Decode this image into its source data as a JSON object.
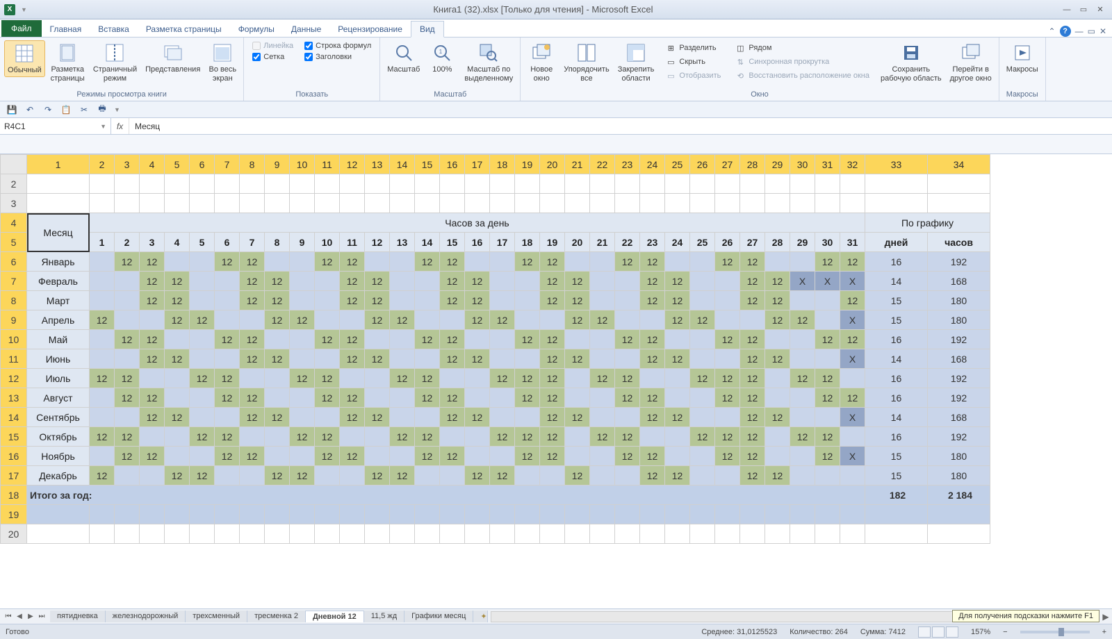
{
  "title": "Книга1 (32).xlsx  [Только для чтения]  -  Microsoft Excel",
  "tabs": {
    "file": "Файл",
    "home": "Главная",
    "insert": "Вставка",
    "layout": "Разметка страницы",
    "formulas": "Формулы",
    "data": "Данные",
    "review": "Рецензирование",
    "view": "Вид"
  },
  "ribbon": {
    "views": {
      "normal": "Обычный",
      "page_layout": "Разметка\nстраницы",
      "page_break": "Страничный\nрежим",
      "custom": "Представления",
      "full": "Во весь\nэкран",
      "group": "Режимы просмотра книги"
    },
    "show": {
      "ruler": "Линейка",
      "formula_bar": "Строка формул",
      "gridlines": "Сетка",
      "headings": "Заголовки",
      "group": "Показать"
    },
    "zoom": {
      "zoom": "Масштаб",
      "hundred": "100%",
      "selection": "Масштаб по\nвыделенному",
      "group": "Масштаб"
    },
    "window": {
      "new": "Новое\nокно",
      "arrange": "Упорядочить\nвсе",
      "freeze": "Закрепить\nобласти",
      "split": "Разделить",
      "hide": "Скрыть",
      "unhide": "Отобразить",
      "side": "Рядом",
      "sync": "Синхронная прокрутка",
      "reset": "Восстановить расположение окна",
      "save_ws": "Сохранить\nрабочую область",
      "switch": "Перейти в\nдругое окно",
      "group": "Окно"
    },
    "macros": {
      "label": "Макросы",
      "group": "Макросы"
    }
  },
  "namebox": "R4C1",
  "formula": "Месяц",
  "cols": [
    "1",
    "2",
    "3",
    "4",
    "5",
    "6",
    "7",
    "8",
    "9",
    "10",
    "11",
    "12",
    "13",
    "14",
    "15",
    "16",
    "17",
    "18",
    "19",
    "20",
    "21",
    "22",
    "23",
    "24",
    "25",
    "26",
    "27",
    "28",
    "29",
    "30",
    "31",
    "32",
    "33",
    "34"
  ],
  "rows": [
    "2",
    "3",
    "4",
    "5",
    "6",
    "7",
    "8",
    "9",
    "10",
    "11",
    "12",
    "13",
    "14",
    "15",
    "16",
    "17",
    "18",
    "19",
    "20"
  ],
  "table": {
    "month_header": "Месяц",
    "hours_per_day": "Часов за день",
    "by_schedule": "По графику",
    "days": [
      "1",
      "2",
      "3",
      "4",
      "5",
      "6",
      "7",
      "8",
      "9",
      "10",
      "11",
      "12",
      "13",
      "14",
      "15",
      "16",
      "17",
      "18",
      "19",
      "20",
      "21",
      "22",
      "23",
      "24",
      "25",
      "26",
      "27",
      "28",
      "29",
      "30",
      "31"
    ],
    "days_label": "дней",
    "hours_label": "часов",
    "months": [
      {
        "name": "Январь",
        "cells": [
          "",
          "12",
          "12",
          "",
          "",
          "12",
          "12",
          "",
          "",
          "12",
          "12",
          "",
          "",
          "12",
          "12",
          "",
          "",
          "12",
          "12",
          "",
          "",
          "12",
          "12",
          "",
          "",
          "12",
          "12",
          "",
          "",
          "12",
          "12"
        ],
        "days": "16",
        "hours": "192"
      },
      {
        "name": "Февраль",
        "cells": [
          "",
          "",
          "12",
          "12",
          "",
          "",
          "12",
          "12",
          "",
          "",
          "12",
          "12",
          "",
          "",
          "12",
          "12",
          "",
          "",
          "12",
          "12",
          "",
          "",
          "12",
          "12",
          "",
          "",
          "12",
          "12",
          "X",
          "X",
          "X"
        ],
        "days": "14",
        "hours": "168"
      },
      {
        "name": "Март",
        "cells": [
          "",
          "",
          "12",
          "12",
          "",
          "",
          "12",
          "12",
          "",
          "",
          "12",
          "12",
          "",
          "",
          "12",
          "12",
          "",
          "",
          "12",
          "12",
          "",
          "",
          "12",
          "12",
          "",
          "",
          "12",
          "12",
          "",
          "",
          "12"
        ],
        "days": "15",
        "hours": "180"
      },
      {
        "name": "Апрель",
        "cells": [
          "12",
          "",
          "",
          "12",
          "12",
          "",
          "",
          "12",
          "12",
          "",
          "",
          "12",
          "12",
          "",
          "",
          "12",
          "12",
          "",
          "",
          "12",
          "12",
          "",
          "",
          "12",
          "12",
          "",
          "",
          "12",
          "12",
          "",
          "X"
        ],
        "days": "15",
        "hours": "180"
      },
      {
        "name": "Май",
        "cells": [
          "",
          "12",
          "12",
          "",
          "",
          "12",
          "12",
          "",
          "",
          "12",
          "12",
          "",
          "",
          "12",
          "12",
          "",
          "",
          "12",
          "12",
          "",
          "",
          "12",
          "12",
          "",
          "",
          "12",
          "12",
          "",
          "",
          "12",
          "12"
        ],
        "days": "16",
        "hours": "192"
      },
      {
        "name": "Июнь",
        "cells": [
          "",
          "",
          "12",
          "12",
          "",
          "",
          "12",
          "12",
          "",
          "",
          "12",
          "12",
          "",
          "",
          "12",
          "12",
          "",
          "",
          "12",
          "12",
          "",
          "",
          "12",
          "12",
          "",
          "",
          "12",
          "12",
          "",
          "",
          "X"
        ],
        "days": "14",
        "hours": "168"
      },
      {
        "name": "Июль",
        "cells": [
          "12",
          "12",
          "",
          "",
          "12",
          "12",
          "",
          "",
          "12",
          "12",
          "",
          "",
          "12",
          "12",
          "",
          "",
          "12",
          "12",
          "12",
          "",
          "12",
          "12",
          "",
          "",
          "12",
          "12",
          "12",
          "",
          "12",
          "12",
          ""
        ],
        "days": "16",
        "hours": "192"
      },
      {
        "name": "Август",
        "cells": [
          "",
          "12",
          "12",
          "",
          "",
          "12",
          "12",
          "",
          "",
          "12",
          "12",
          "",
          "",
          "12",
          "12",
          "",
          "",
          "12",
          "12",
          "",
          "",
          "12",
          "12",
          "",
          "",
          "12",
          "12",
          "",
          "",
          "12",
          "12"
        ],
        "days": "16",
        "hours": "192"
      },
      {
        "name": "Сентябрь",
        "cells": [
          "",
          "",
          "12",
          "12",
          "",
          "",
          "12",
          "12",
          "",
          "",
          "12",
          "12",
          "",
          "",
          "12",
          "12",
          "",
          "",
          "12",
          "12",
          "",
          "",
          "12",
          "12",
          "",
          "",
          "12",
          "12",
          "",
          "",
          "X"
        ],
        "days": "14",
        "hours": "168"
      },
      {
        "name": "Октябрь",
        "cells": [
          "12",
          "12",
          "",
          "",
          "12",
          "12",
          "",
          "",
          "12",
          "12",
          "",
          "",
          "12",
          "12",
          "",
          "",
          "12",
          "12",
          "12",
          "",
          "12",
          "12",
          "",
          "",
          "12",
          "12",
          "12",
          "",
          "12",
          "12",
          ""
        ],
        "days": "16",
        "hours": "192"
      },
      {
        "name": "Ноябрь",
        "cells": [
          "",
          "12",
          "12",
          "",
          "",
          "12",
          "12",
          "",
          "",
          "12",
          "12",
          "",
          "",
          "12",
          "12",
          "",
          "",
          "12",
          "12",
          "",
          "",
          "12",
          "12",
          "",
          "",
          "12",
          "12",
          "",
          "",
          "12",
          "X"
        ],
        "days": "15",
        "hours": "180"
      },
      {
        "name": "Декабрь",
        "cells": [
          "12",
          "",
          "",
          "12",
          "12",
          "",
          "",
          "12",
          "12",
          "",
          "",
          "12",
          "12",
          "",
          "",
          "12",
          "12",
          "",
          "",
          "12",
          "",
          "",
          "12",
          "12",
          "",
          "",
          "12",
          "12",
          "",
          "",
          ""
        ],
        "days": "15",
        "hours": "180"
      }
    ],
    "total_label": "Итого за год:",
    "total_days": "182",
    "total_hours": "2 184"
  },
  "sheet_tabs": [
    "пятидневка",
    "железнодорожный",
    "трехсменный",
    "тресменка 2",
    "Дневной 12",
    "11,5 жд",
    "Графики месяц"
  ],
  "active_sheet": 4,
  "status": {
    "ready": "Готово",
    "avg_label": "Среднее:",
    "avg": "31,0125523",
    "count_label": "Количество:",
    "count": "264",
    "sum_label": "Сумма:",
    "sum": "7412",
    "zoom": "157%",
    "hint": "Для получения подсказки нажмите F1"
  }
}
